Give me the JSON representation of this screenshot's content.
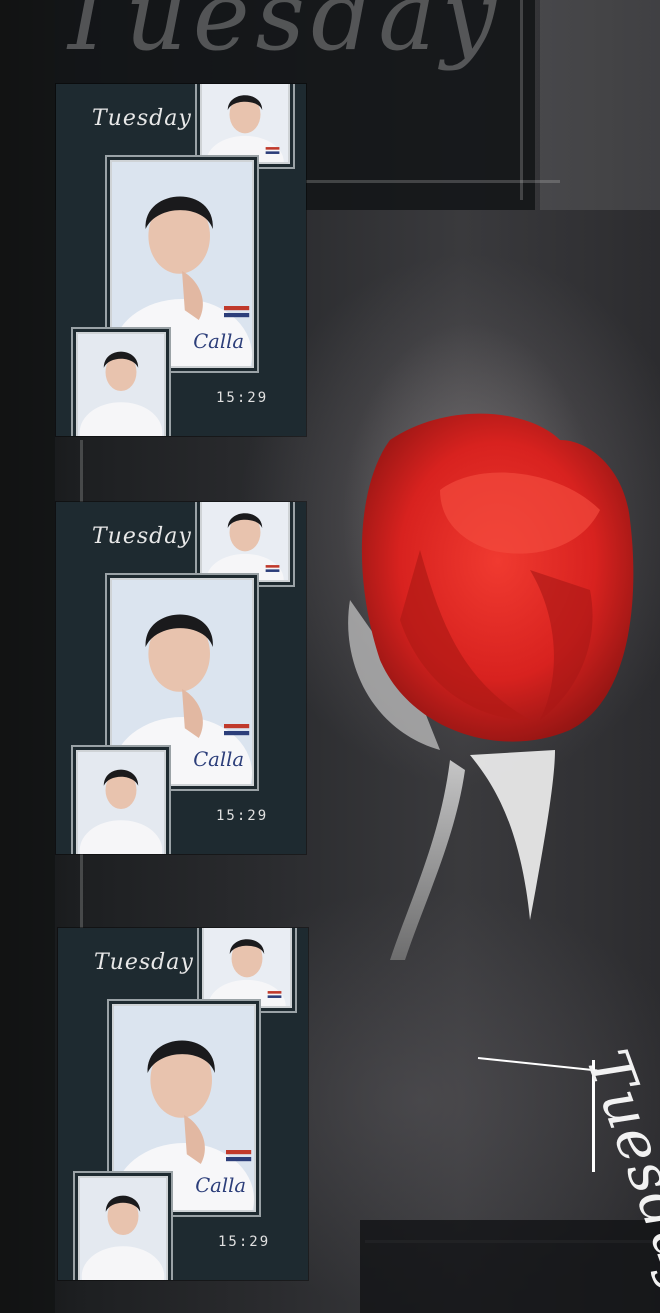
{
  "background": {
    "script_top": "Tuesday",
    "colors": {
      "base": "#1c1d1f",
      "rose": "#d8221f",
      "card": "#1e2a30"
    }
  },
  "cards": [
    {
      "title": "Tuesday",
      "time": "15:29"
    },
    {
      "title": "Tuesday",
      "time": "15:29"
    },
    {
      "title": "Tuesday",
      "time": "15:29"
    }
  ],
  "side_script": "Tuesday"
}
